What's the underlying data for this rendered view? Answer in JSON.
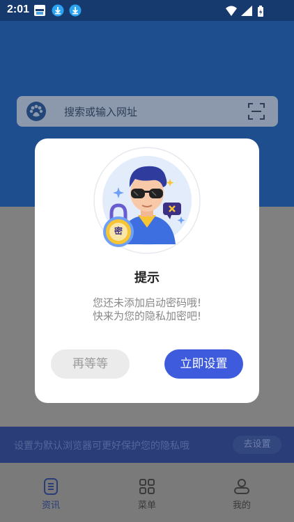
{
  "status_bar": {
    "time": "2:01",
    "icons": [
      "app-notification-icon",
      "download-icon",
      "download-icon",
      "wifi-icon",
      "signal-icon",
      "battery-charging-icon"
    ]
  },
  "search": {
    "placeholder": "搜索或输入网址"
  },
  "dialog": {
    "title": "提示",
    "message_line1": "您还未添加启动密码哦!",
    "message_line2": "快来为您的隐私加密吧!",
    "badge_char": "密",
    "cancel_label": "再等等",
    "confirm_label": "立即设置"
  },
  "banner": {
    "text": "设置为默认浏览器可更好保护您的隐私哦",
    "button_label": "去设置"
  },
  "bottom_nav": {
    "items": [
      {
        "label": "资讯",
        "icon": "news-icon",
        "active": true
      },
      {
        "label": "菜单",
        "icon": "grid-menu-icon",
        "active": false
      },
      {
        "label": "我的",
        "icon": "profile-icon",
        "active": false
      }
    ]
  },
  "colors": {
    "primary": "#3d5bdc",
    "header": "#1f4e8f",
    "overlay_header": "#163a6e"
  }
}
